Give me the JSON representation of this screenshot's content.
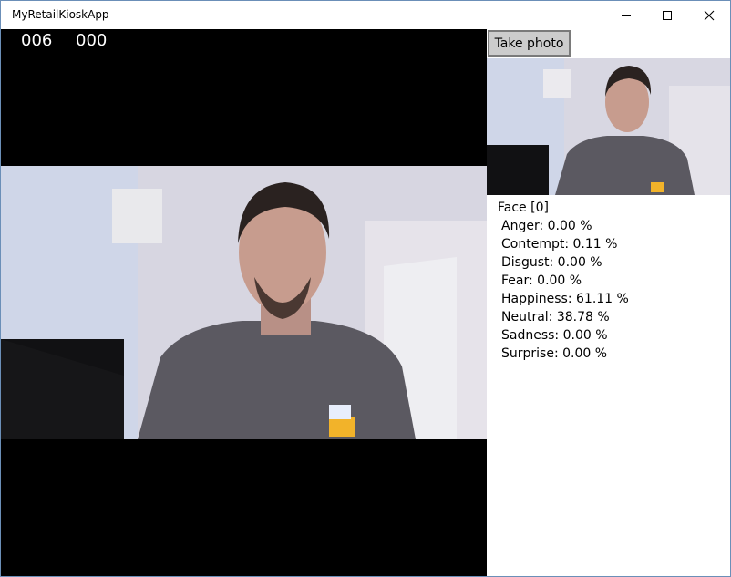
{
  "window": {
    "title": "MyRetailKioskApp"
  },
  "counters": {
    "left": "006",
    "right": "000"
  },
  "toolbar": {
    "take_photo_label": "Take photo"
  },
  "icons": {
    "minimize": "minimize-icon",
    "maximize": "maximize-icon",
    "close": "close-icon"
  },
  "face": {
    "header": "Face [0]",
    "emotions": [
      {
        "label": "Anger: 0.00 %"
      },
      {
        "label": "Contempt: 0.11 %"
      },
      {
        "label": "Disgust: 0.00 %"
      },
      {
        "label": "Fear: 0.00 %"
      },
      {
        "label": "Happiness: 61.11 %"
      },
      {
        "label": "Neutral: 38.78 %"
      },
      {
        "label": "Sadness: 0.00 %"
      },
      {
        "label": "Surprise: 0.00 %"
      }
    ]
  },
  "colors": {
    "video_background": "#000000",
    "button_background": "#cccccc",
    "window_border": "#6b8fb8"
  }
}
